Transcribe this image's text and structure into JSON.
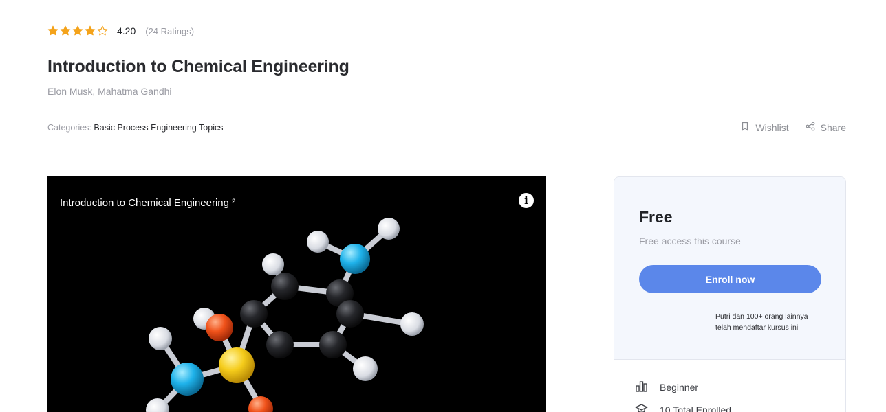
{
  "course": {
    "rating": {
      "stars_filled": 4,
      "stars_total": 5,
      "value": "4.20",
      "count_text": "(24 Ratings)",
      "star_color": "#f4a31b"
    },
    "title": "Introduction to Chemical Engineering",
    "authors": "Elon Musk, Mahatma Gandhi",
    "categories_label": "Categories:",
    "categories_value": "Basic Process Engineering Topics",
    "actions": {
      "wishlist_label": "Wishlist",
      "wishlist_icon": "bookmark-icon",
      "share_label": "Share",
      "share_icon": "share-icon"
    }
  },
  "video": {
    "title": "Introduction to Chemical Engineering ²",
    "info_icon": "info-icon"
  },
  "sidebar_card": {
    "price": "Free",
    "price_subtitle": "Free access this course",
    "enroll_label": "Enroll now",
    "enroll_color": "#5b87ea",
    "social_proof_line1": "Putri dan 100+ orang lainnya",
    "social_proof_line2": "telah mendaftar kursus ini",
    "meta": [
      {
        "icon": "level-bars-icon",
        "label": "Beginner"
      },
      {
        "icon": "graduation-cap-icon",
        "label": "10 Total Enrolled"
      }
    ]
  }
}
